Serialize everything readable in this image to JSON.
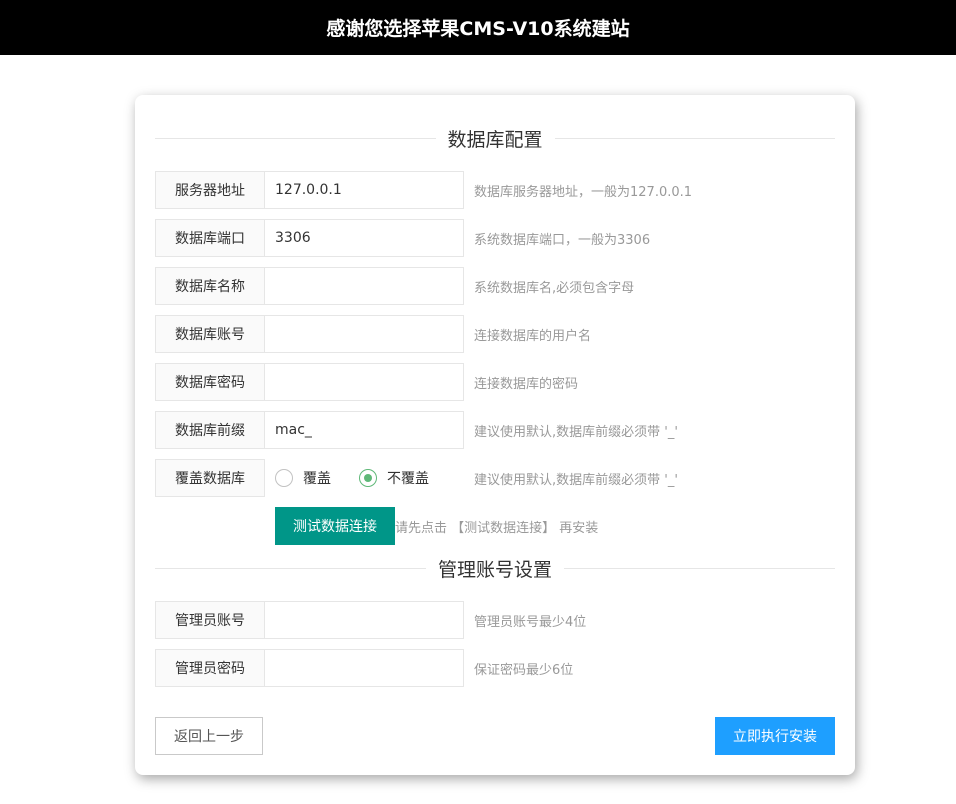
{
  "header": {
    "title": "感谢您选择苹果CMS-V10系统建站"
  },
  "db_section": {
    "title": "数据库配置"
  },
  "db_fields": [
    {
      "label": "服务器地址",
      "value": "127.0.0.1",
      "tip": "数据库服务器地址，一般为127.0.0.1"
    },
    {
      "label": "数据库端口",
      "value": "3306",
      "tip": "系统数据库端口，一般为3306"
    },
    {
      "label": "数据库名称",
      "value": "",
      "tip": "系统数据库名,必须包含字母"
    },
    {
      "label": "数据库账号",
      "value": "",
      "tip": "连接数据库的用户名"
    },
    {
      "label": "数据库密码",
      "value": "",
      "tip": "连接数据库的密码"
    },
    {
      "label": "数据库前缀",
      "value": "mac_",
      "tip": "建议使用默认,数据库前缀必须带 '_'"
    }
  ],
  "overwrite": {
    "label": "覆盖数据库",
    "options": [
      {
        "label": "覆盖",
        "checked": false
      },
      {
        "label": "不覆盖",
        "checked": true
      }
    ],
    "tip": "建议使用默认,数据库前缀必须带 '_'"
  },
  "test": {
    "button": "测试数据连接",
    "tip": "请先点击 【测试数据连接】 再安装"
  },
  "admin_section": {
    "title": "管理账号设置"
  },
  "admin_fields": [
    {
      "label": "管理员账号",
      "value": "",
      "tip": "管理员账号最少4位"
    },
    {
      "label": "管理员密码",
      "value": "",
      "tip": "保证密码最少6位"
    }
  ],
  "footer": {
    "back": "返回上一步",
    "install": "立即执行安装"
  },
  "colors": {
    "header_bg": "#000000",
    "test_btn": "#009688",
    "install_btn": "#1e9fff",
    "radio_checked": "#5fb878"
  }
}
